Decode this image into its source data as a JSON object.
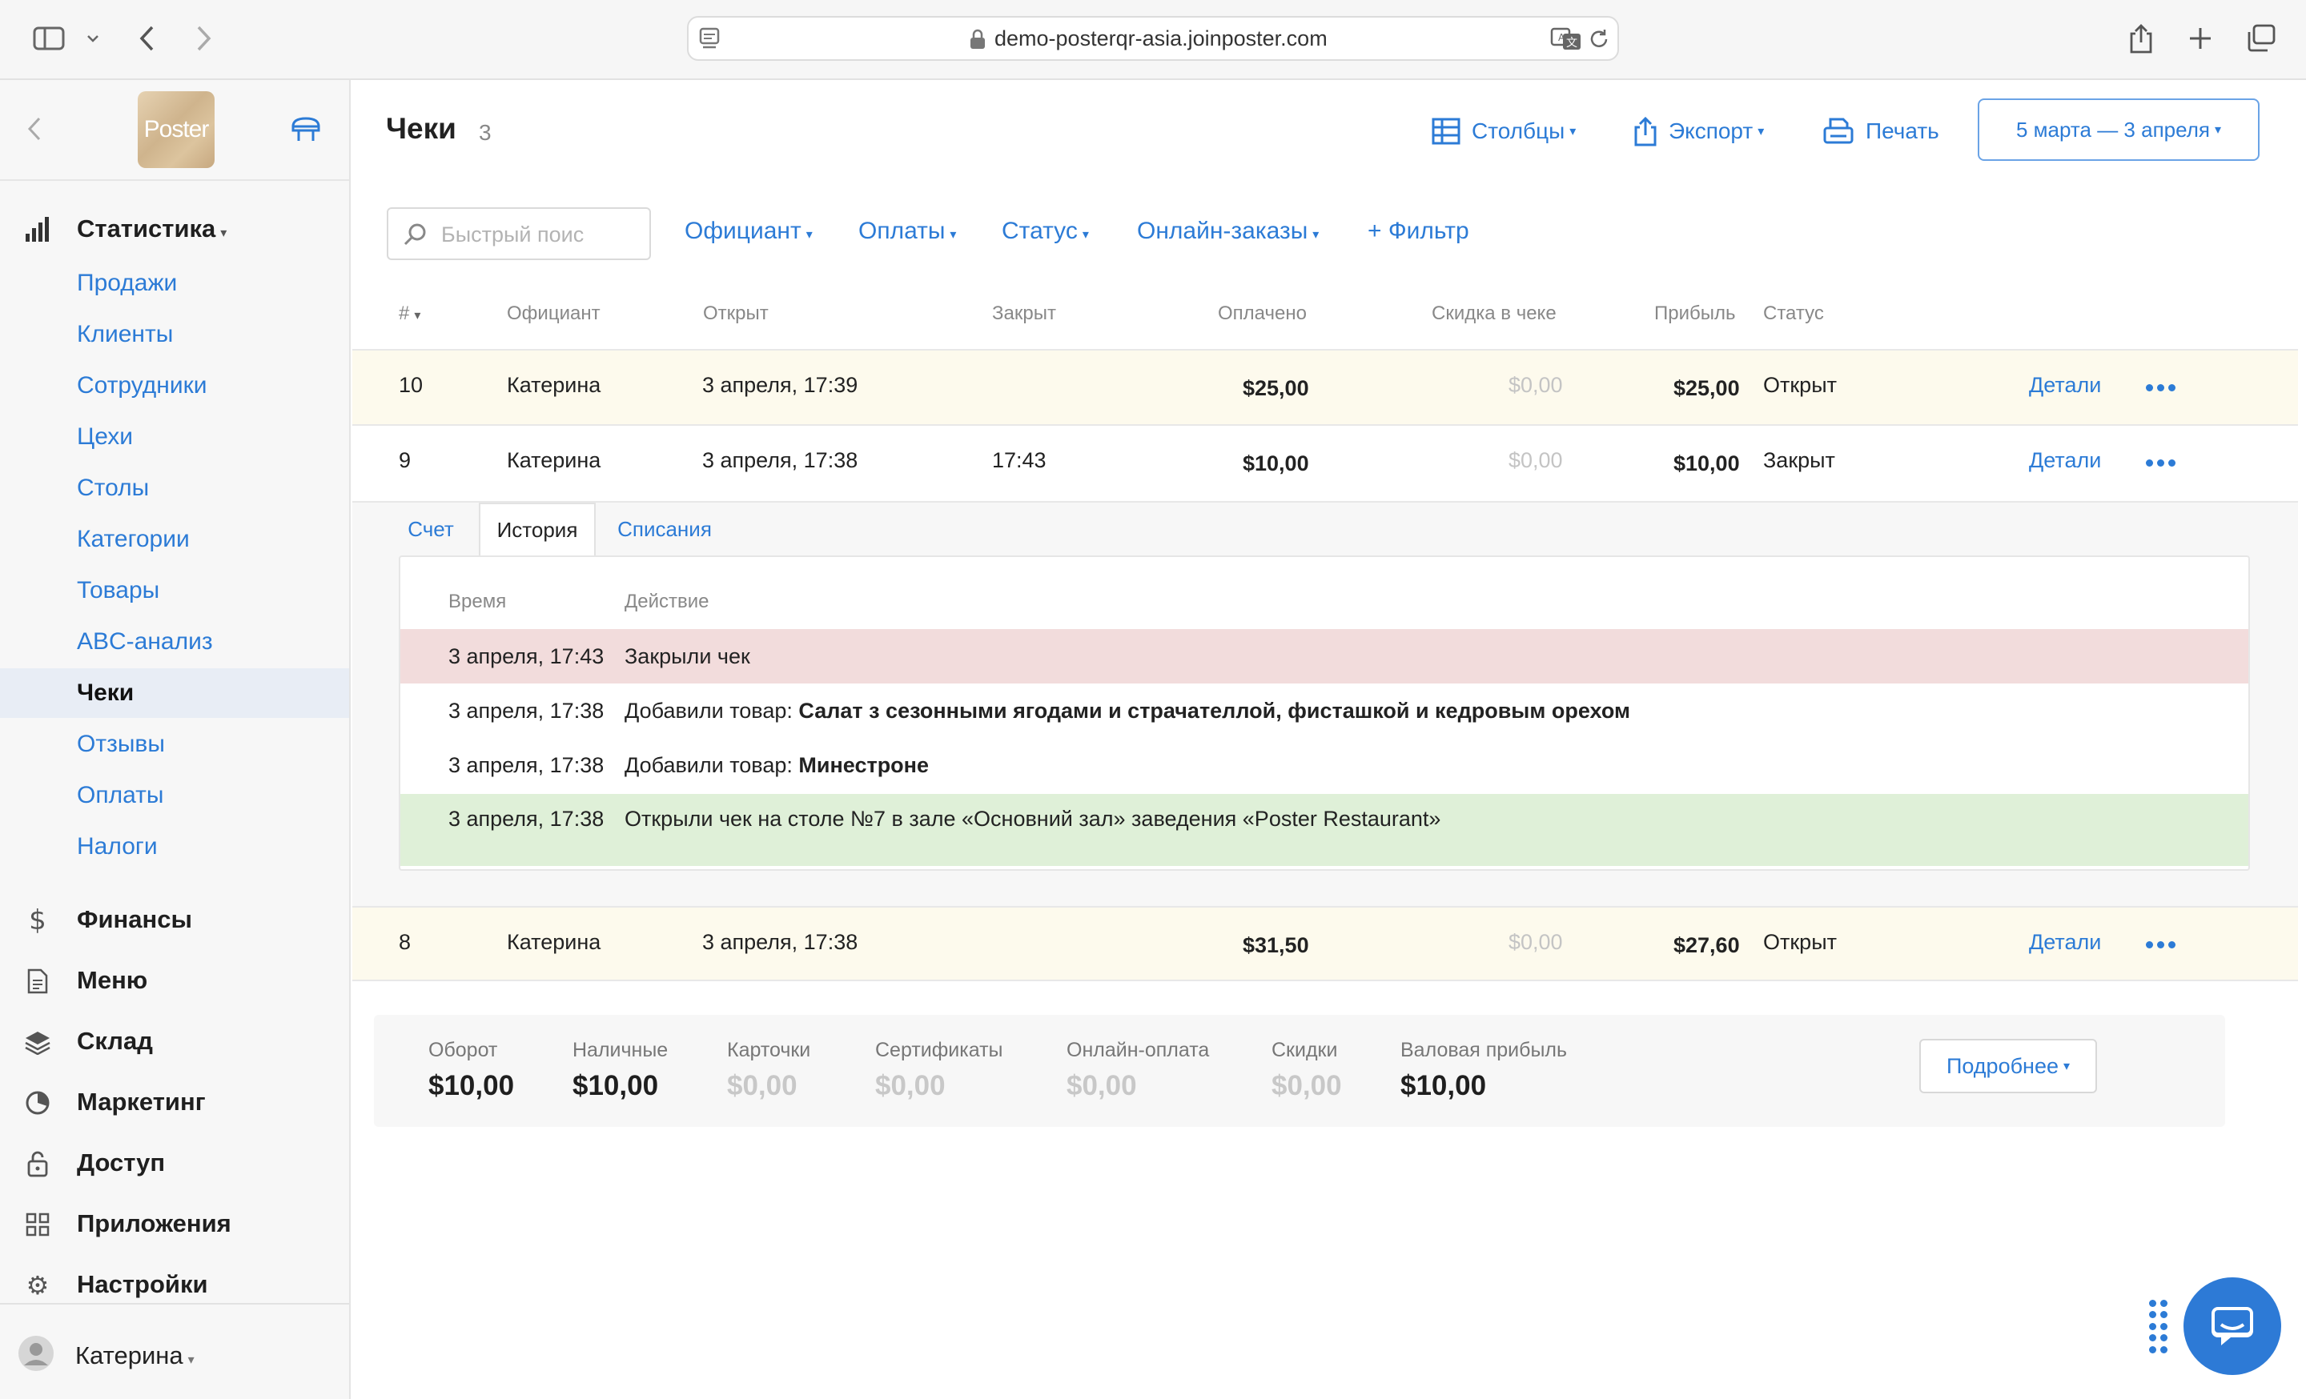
{
  "browser": {
    "url": "demo-posterqr-asia.joinposter.com"
  },
  "sidebar": {
    "logo_text": "Poster",
    "statistics_label": "Статистика",
    "stats_items": [
      {
        "label": "Продажи"
      },
      {
        "label": "Клиенты"
      },
      {
        "label": "Сотрудники"
      },
      {
        "label": "Цехи"
      },
      {
        "label": "Столы"
      },
      {
        "label": "Категории"
      },
      {
        "label": "Товары"
      },
      {
        "label": "ABC-анализ"
      },
      {
        "label": "Чеки",
        "active": true
      },
      {
        "label": "Отзывы"
      },
      {
        "label": "Оплаты"
      },
      {
        "label": "Налоги"
      }
    ],
    "sections": [
      {
        "label": "Финансы",
        "icon": "dollar-icon"
      },
      {
        "label": "Меню",
        "icon": "document-icon"
      },
      {
        "label": "Склад",
        "icon": "layers-icon"
      },
      {
        "label": "Маркетинг",
        "icon": "pie-icon"
      },
      {
        "label": "Доступ",
        "icon": "lock-icon"
      },
      {
        "label": "Приложения",
        "icon": "grid-icon"
      },
      {
        "label": "Настройки",
        "icon": "gear-icon"
      }
    ],
    "user_name": "Катерина"
  },
  "header": {
    "title": "Чеки",
    "count": "3",
    "columns_btn": "Столбцы",
    "export_btn": "Экспорт",
    "print_btn": "Печать",
    "date_range": "5 марта — 3 апреля"
  },
  "filters": {
    "search_placeholder": "Быстрый поис",
    "waiter": "Официант",
    "payments": "Оплаты",
    "status": "Статус",
    "online_orders": "Онлайн-заказы",
    "add_filter": "+ Фильтр"
  },
  "table": {
    "headers": {
      "num": "#",
      "waiter": "Официант",
      "opened": "Открыт",
      "closed": "Закрыт",
      "paid": "Оплачено",
      "discount": "Скидка в чеке",
      "profit": "Прибыль",
      "status": "Статус"
    },
    "details_label": "Детали",
    "rows": [
      {
        "num": "10",
        "waiter": "Катерина",
        "opened": "3 апреля, 17:39",
        "closed": "",
        "paid": "$25,00",
        "discount": "$0,00",
        "profit": "$25,00",
        "status": "Открыт"
      },
      {
        "num": "9",
        "waiter": "Катерина",
        "opened": "3 апреля, 17:38",
        "closed": "17:43",
        "paid": "$10,00",
        "discount": "$0,00",
        "profit": "$10,00",
        "status": "Закрыт"
      },
      {
        "num": "8",
        "waiter": "Катерина",
        "opened": "3 апреля, 17:38",
        "closed": "",
        "paid": "$31,50",
        "discount": "$0,00",
        "profit": "$27,60",
        "status": "Открыт"
      }
    ]
  },
  "detail": {
    "tabs": [
      "Счет",
      "История",
      "Списания"
    ],
    "history_headers": {
      "time": "Время",
      "action": "Действие"
    },
    "history": [
      {
        "time": "3 апреля, 17:43",
        "action": "Закрыли чек",
        "item": ""
      },
      {
        "time": "3 апреля, 17:38",
        "action": "Добавили товар: ",
        "item": "Салат з сезонными ягодами и страчателлой, фисташкой и кедровым орехом"
      },
      {
        "time": "3 апреля, 17:38",
        "action": "Добавили товар: ",
        "item": "Минестроне"
      },
      {
        "time": "3 апреля, 17:38",
        "action": "Открыли чек на столе №7 в зале «Основний зал» заведения «Poster Restaurant»",
        "item": ""
      }
    ]
  },
  "summary": {
    "items": [
      {
        "label": "Оборот",
        "value": "$10,00"
      },
      {
        "label": "Наличные",
        "value": "$10,00"
      },
      {
        "label": "Карточки",
        "value": "$0,00"
      },
      {
        "label": "Сертификаты",
        "value": "$0,00"
      },
      {
        "label": "Онлайн-оплата",
        "value": "$0,00"
      },
      {
        "label": "Скидки",
        "value": "$0,00"
      },
      {
        "label": "Валовая прибыль",
        "value": "$10,00"
      }
    ],
    "more_btn": "Подробнее"
  },
  "colors": {
    "accent": "#2c7bd6",
    "open_row": "#fdfaed",
    "history_closed": "#f2dcdc",
    "history_opened": "#dff0d8"
  }
}
